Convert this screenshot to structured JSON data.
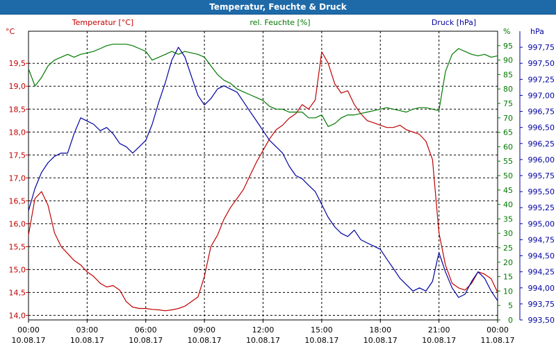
{
  "window": {
    "title": "Temperatur, Feuchte & Druck"
  },
  "colors": {
    "temperature": "#c00000",
    "humidity": "#007800",
    "pressure": "#0000a0",
    "title_bar": "#1e6aa9",
    "grid": "#000000"
  },
  "chart_data": {
    "type": "line",
    "title": "Temperatur, Feuchte & Druck",
    "grid": true,
    "x_ticks": [
      {
        "time": "00:00",
        "date": "10.08.17"
      },
      {
        "time": "03:00",
        "date": "10.08.17"
      },
      {
        "time": "06:00",
        "date": "10.08.17"
      },
      {
        "time": "09:00",
        "date": "10.08.17"
      },
      {
        "time": "12:00",
        "date": "10.08.17"
      },
      {
        "time": "15:00",
        "date": "10.08.17"
      },
      {
        "time": "18:00",
        "date": "10.08.17"
      },
      {
        "time": "21:00",
        "date": "10.08.17"
      },
      {
        "time": "00:00",
        "date": "11.08.17"
      }
    ],
    "x_label_unit": "hours",
    "axes": {
      "temperature": {
        "label": "Temperatur [°C]",
        "unit": "°C",
        "position": "left",
        "range": [
          13.9,
          20.2
        ],
        "ticks": [
          "14,0",
          "14,5",
          "15,0",
          "15,5",
          "16,0",
          "16,5",
          "17,0",
          "17,5",
          "18,0",
          "18,5",
          "19,0",
          "19,5"
        ],
        "tick_values": [
          14.0,
          14.5,
          15.0,
          15.5,
          16.0,
          16.5,
          17.0,
          17.5,
          18.0,
          18.5,
          19.0,
          19.5
        ]
      },
      "humidity": {
        "label": "rel. Feuchte [%]",
        "unit": "%",
        "position": "right",
        "range": [
          0,
          100
        ],
        "ticks": [
          "0",
          "5",
          "10",
          "15",
          "20",
          "25",
          "30",
          "35",
          "40",
          "45",
          "50",
          "55",
          "60",
          "65",
          "70",
          "75",
          "80",
          "85",
          "90",
          "95"
        ],
        "tick_values": [
          0,
          5,
          10,
          15,
          20,
          25,
          30,
          35,
          40,
          45,
          50,
          55,
          60,
          65,
          70,
          75,
          80,
          85,
          90,
          95
        ]
      },
      "pressure": {
        "label": "Druck [hPa]",
        "unit": "hPa",
        "position": "far-right",
        "range": [
          993.5,
          998.0
        ],
        "ticks": [
          "993,50",
          "993,75",
          "994,00",
          "994,25",
          "994,50",
          "994,75",
          "995,00",
          "995,25",
          "995,50",
          "995,75",
          "996,00",
          "996,25",
          "996,50",
          "996,75",
          "997,00",
          "997,25",
          "997,50",
          "997,75"
        ],
        "tick_values": [
          993.5,
          993.75,
          994.0,
          994.25,
          994.5,
          994.75,
          995.0,
          995.25,
          995.5,
          995.75,
          996.0,
          996.25,
          996.5,
          996.75,
          997.0,
          997.25,
          997.5,
          997.75
        ]
      }
    },
    "series": [
      {
        "name": "Temperatur [°C]",
        "axis": "temperature",
        "color": "#c00000",
        "x": [
          0,
          0.33,
          0.67,
          1,
          1.33,
          1.67,
          2,
          2.33,
          2.67,
          3,
          3.33,
          3.67,
          4,
          4.33,
          4.67,
          5,
          5.33,
          5.67,
          6,
          6.33,
          6.67,
          7,
          7.33,
          7.67,
          8,
          8.33,
          8.67,
          9,
          9.33,
          9.67,
          10,
          10.33,
          10.67,
          11,
          11.33,
          11.67,
          12,
          12.33,
          12.67,
          13,
          13.33,
          13.67,
          14,
          14.33,
          14.67,
          15,
          15.33,
          15.67,
          16,
          16.33,
          16.67,
          17,
          17.33,
          17.67,
          18,
          18.33,
          18.67,
          19,
          19.33,
          19.67,
          20,
          20.33,
          20.67,
          21,
          21.33,
          21.67,
          22,
          22.33,
          22.67,
          23,
          23.33,
          23.67,
          24
        ],
        "values": [
          15.75,
          16.55,
          16.7,
          16.4,
          15.8,
          15.5,
          15.35,
          15.2,
          15.1,
          14.95,
          14.85,
          14.7,
          14.62,
          14.65,
          14.55,
          14.3,
          14.18,
          14.15,
          14.15,
          14.13,
          14.12,
          14.1,
          14.12,
          14.15,
          14.2,
          14.3,
          14.4,
          14.85,
          15.5,
          15.75,
          16.1,
          16.35,
          16.55,
          16.75,
          17.05,
          17.35,
          17.6,
          17.85,
          18.05,
          18.15,
          18.3,
          18.4,
          18.6,
          18.5,
          18.7,
          19.75,
          19.5,
          19.05,
          18.85,
          18.9,
          18.6,
          18.4,
          18.25,
          18.2,
          18.15,
          18.1,
          18.1,
          18.15,
          18.05,
          18.0,
          17.95,
          17.8,
          17.4,
          15.8,
          15.1,
          14.7,
          14.6,
          14.55,
          14.7,
          14.95,
          14.9,
          14.8,
          14.5
        ],
        "extremes": {
          "min": 14.1,
          "max": 19.75
        }
      },
      {
        "name": "rel. Feuchte [%]",
        "axis": "humidity",
        "color": "#007800",
        "x": [
          0,
          0.33,
          0.67,
          1,
          1.33,
          1.67,
          2,
          2.33,
          2.67,
          3,
          3.33,
          3.67,
          4,
          4.33,
          4.67,
          5,
          5.33,
          5.67,
          6,
          6.33,
          6.67,
          7,
          7.33,
          7.67,
          8,
          8.33,
          8.67,
          9,
          9.33,
          9.67,
          10,
          10.33,
          10.67,
          11,
          11.33,
          11.67,
          12,
          12.33,
          12.67,
          13,
          13.33,
          13.67,
          14,
          14.33,
          14.67,
          15,
          15.33,
          15.67,
          16,
          16.33,
          16.67,
          17,
          17.33,
          17.67,
          18,
          18.33,
          18.67,
          19,
          19.33,
          19.67,
          20,
          20.33,
          20.67,
          21,
          21.33,
          21.67,
          22,
          22.33,
          22.67,
          23,
          23.33,
          23.67,
          24
        ],
        "values": [
          87,
          81,
          84,
          88,
          90,
          91,
          92,
          91,
          92,
          92.5,
          93,
          94,
          95,
          95.5,
          95.5,
          95.5,
          95,
          94,
          93,
          90,
          91,
          92,
          93,
          92,
          93,
          92.5,
          92,
          91,
          88,
          85,
          83,
          82,
          80,
          79,
          78,
          77,
          76,
          74,
          73,
          73,
          72,
          72,
          72,
          70,
          70,
          71,
          67,
          68,
          70,
          71,
          71,
          71.5,
          72,
          72.5,
          73,
          73.5,
          73,
          72.5,
          72,
          73,
          73.5,
          73.5,
          73,
          72.5,
          86,
          92,
          94,
          93,
          92,
          91.5,
          92,
          91,
          91.5
        ],
        "extremes": {
          "min": 67,
          "max": 95.5
        }
      },
      {
        "name": "Druck [hPa]",
        "axis": "pressure",
        "color": "#0000a0",
        "x": [
          0,
          0.33,
          0.67,
          1,
          1.33,
          1.67,
          2,
          2.33,
          2.67,
          3,
          3.33,
          3.67,
          4,
          4.33,
          4.67,
          5,
          5.33,
          5.67,
          6,
          6.33,
          6.67,
          7,
          7.33,
          7.67,
          8,
          8.33,
          8.67,
          9,
          9.33,
          9.67,
          10,
          10.33,
          10.67,
          11,
          11.33,
          11.67,
          12,
          12.33,
          12.67,
          13,
          13.33,
          13.67,
          14,
          14.33,
          14.67,
          15,
          15.33,
          15.67,
          16,
          16.33,
          16.67,
          17,
          17.33,
          17.67,
          18,
          18.33,
          18.67,
          19,
          19.33,
          19.67,
          20,
          20.33,
          20.67,
          21,
          21.33,
          21.67,
          22,
          22.33,
          22.67,
          23,
          23.33,
          23.67,
          24
        ],
        "values": [
          995.2,
          995.55,
          995.8,
          995.95,
          996.05,
          996.1,
          996.1,
          996.4,
          996.65,
          996.6,
          996.55,
          996.45,
          996.5,
          996.4,
          996.25,
          996.2,
          996.1,
          996.2,
          996.3,
          996.55,
          996.9,
          997.2,
          997.55,
          997.75,
          997.6,
          997.3,
          997.0,
          996.85,
          996.95,
          997.1,
          997.15,
          997.1,
          997.05,
          996.9,
          996.75,
          996.6,
          996.45,
          996.3,
          996.2,
          996.1,
          995.9,
          995.75,
          995.7,
          995.6,
          995.5,
          995.3,
          995.1,
          994.95,
          994.85,
          994.8,
          994.9,
          994.75,
          994.7,
          994.65,
          994.6,
          994.45,
          994.3,
          994.15,
          994.05,
          993.95,
          994.0,
          993.95,
          994.1,
          994.55,
          994.25,
          994.0,
          993.85,
          993.9,
          994.1,
          994.25,
          994.15,
          993.95,
          993.8
        ],
        "extremes": {
          "min": 993.8,
          "max": 997.75
        }
      }
    ]
  }
}
